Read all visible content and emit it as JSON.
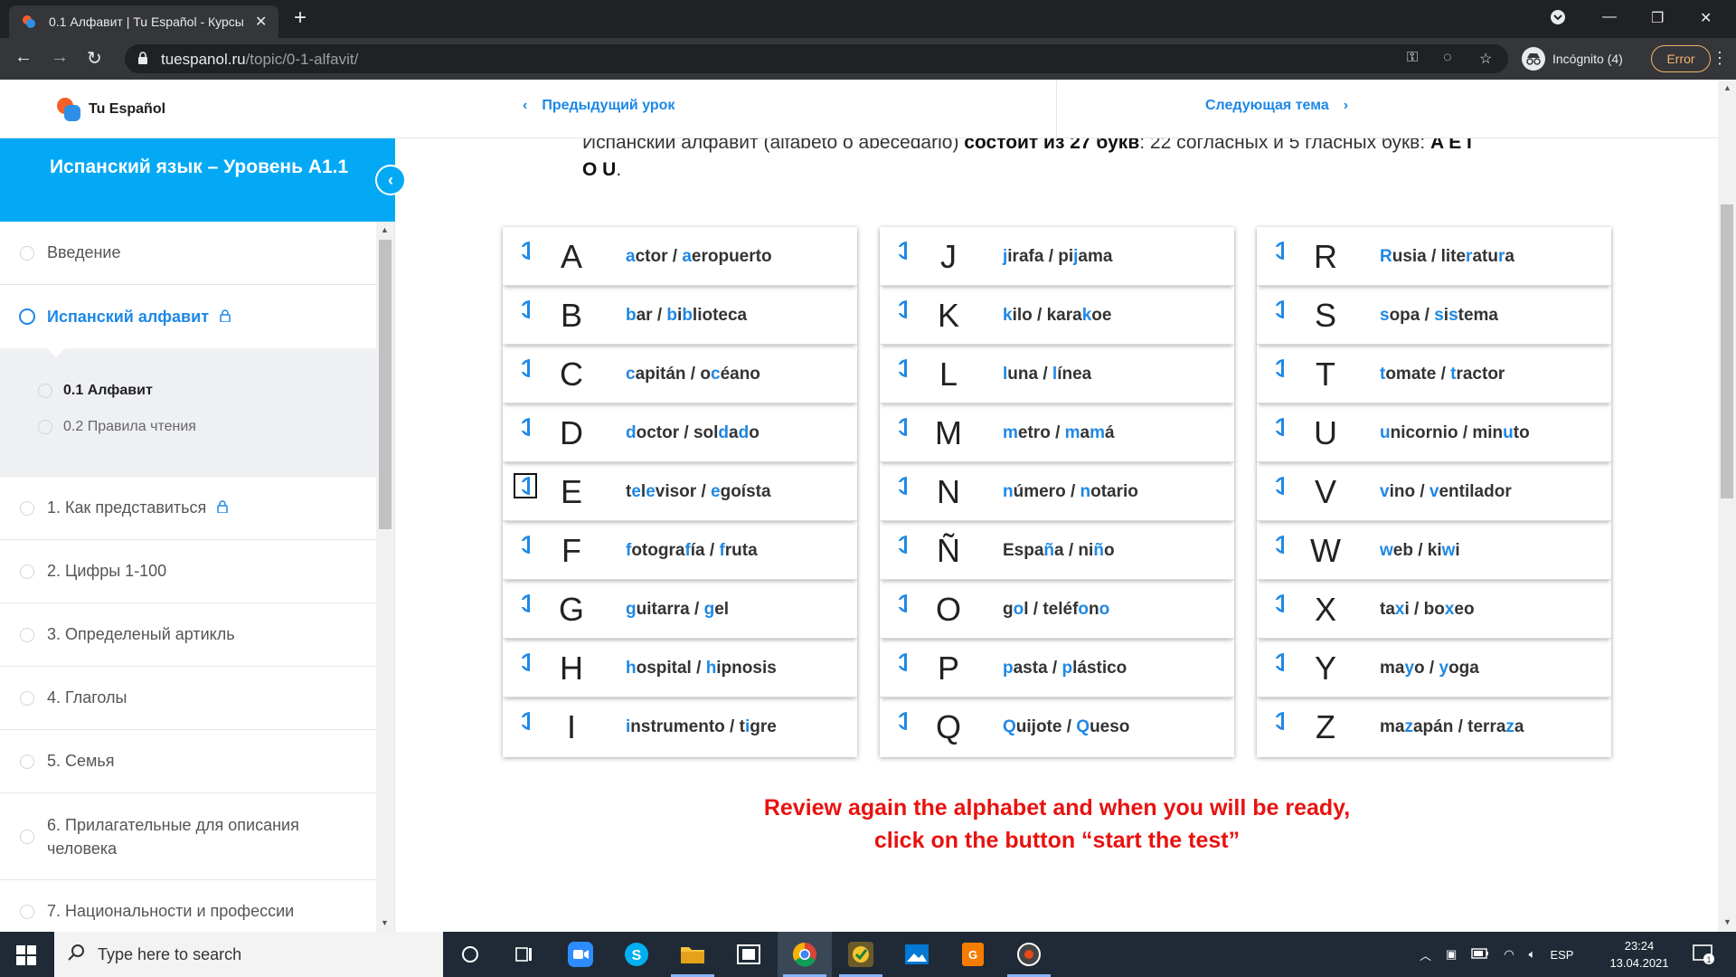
{
  "browser": {
    "tab_title": "0.1 Алфавит | Tu Español - Курсы",
    "url_host": "tuespanol.ru",
    "url_path": "/topic/0-1-alfavit/",
    "incognito_label": "Incógnito (4)",
    "error_label": "Error"
  },
  "header": {
    "logo_text": "Tu Español",
    "prev_label": "Предыдущий урок",
    "next_label": "Следующая тема"
  },
  "sidebar": {
    "course_title": "Испанский язык – Уровень A1.1",
    "items_top": [
      {
        "label": "Введение",
        "active": false,
        "locked": false
      },
      {
        "label": "Испанский алфавит",
        "active": true,
        "locked": true
      }
    ],
    "subtopics": [
      {
        "label": "0.1 Алфавит",
        "current": true
      },
      {
        "label": "0.2 Правила чтения",
        "current": false
      }
    ],
    "items_bottom": [
      {
        "label": "1. Как представиться",
        "locked": true
      },
      {
        "label": "2. Цифры 1-100",
        "locked": false
      },
      {
        "label": "3. Определеный артикль",
        "locked": false
      },
      {
        "label": "4. Глаголы",
        "locked": false
      },
      {
        "label": "5. Семья",
        "locked": false
      },
      {
        "label": "6. Прилагательные для описания человека",
        "locked": false
      },
      {
        "label": "7. Национальности и профессии",
        "locked": false
      }
    ]
  },
  "content": {
    "intro_part1": "Испанский алфавит (alfabeto o abecedario) ",
    "intro_bold1": "состоит из 27 букв",
    "intro_part2": ": 22 согласных и 5 гласных букв: ",
    "intro_bold2": "A E I O U",
    "intro_end": ".",
    "columns": [
      [
        {
          "letter": "A",
          "word": [
            [
              "",
              "a"
            ],
            [
              "ctor / ",
              ""
            ],
            [
              "",
              "a"
            ],
            [
              "eropuerto",
              ""
            ]
          ]
        },
        {
          "letter": "B",
          "word": [
            [
              "",
              "b"
            ],
            [
              "ar / ",
              ""
            ],
            [
              "",
              "b"
            ],
            [
              "i",
              ""
            ],
            [
              "",
              "b"
            ],
            [
              "lioteca",
              ""
            ]
          ]
        },
        {
          "letter": "C",
          "word": [
            [
              "",
              "c"
            ],
            [
              "apitán / o",
              ""
            ],
            [
              "",
              "c"
            ],
            [
              "éano",
              ""
            ]
          ]
        },
        {
          "letter": "D",
          "word": [
            [
              "",
              "d"
            ],
            [
              "octor / sol",
              ""
            ],
            [
              "",
              "d"
            ],
            [
              "a",
              ""
            ],
            [
              "",
              "d"
            ],
            [
              "o",
              ""
            ]
          ]
        },
        {
          "letter": "E",
          "word": [
            [
              "t",
              ""
            ],
            [
              "",
              "e"
            ],
            [
              "l",
              ""
            ],
            [
              "",
              "e"
            ],
            [
              "visor / ",
              ""
            ],
            [
              "",
              "e"
            ],
            [
              "goísta",
              ""
            ]
          ]
        },
        {
          "letter": "F",
          "word": [
            [
              "",
              "f"
            ],
            [
              "otogra",
              ""
            ],
            [
              "",
              "f"
            ],
            [
              "ía / ",
              ""
            ],
            [
              "",
              "f"
            ],
            [
              "ruta",
              ""
            ]
          ]
        },
        {
          "letter": "G",
          "word": [
            [
              "",
              "g"
            ],
            [
              "uitarra / ",
              ""
            ],
            [
              "",
              "g"
            ],
            [
              "el",
              ""
            ]
          ]
        },
        {
          "letter": "H",
          "word": [
            [
              "",
              "h"
            ],
            [
              "ospital / ",
              ""
            ],
            [
              "",
              "h"
            ],
            [
              "ipnosis",
              ""
            ]
          ]
        },
        {
          "letter": "I",
          "word": [
            [
              "",
              "i"
            ],
            [
              "nstrumento / t",
              ""
            ],
            [
              "",
              "i"
            ],
            [
              "gre",
              ""
            ]
          ]
        }
      ],
      [
        {
          "letter": "J",
          "word": [
            [
              "",
              "j"
            ],
            [
              "irafa / pi",
              ""
            ],
            [
              "",
              "j"
            ],
            [
              "ama",
              ""
            ]
          ]
        },
        {
          "letter": "K",
          "word": [
            [
              "",
              "k"
            ],
            [
              "ilo / kara",
              ""
            ],
            [
              "",
              "k"
            ],
            [
              "oe",
              ""
            ]
          ]
        },
        {
          "letter": "L",
          "word": [
            [
              "",
              "l"
            ],
            [
              "una / ",
              ""
            ],
            [
              "",
              "l"
            ],
            [
              "ínea",
              ""
            ]
          ]
        },
        {
          "letter": "M",
          "word": [
            [
              "",
              "m"
            ],
            [
              "etro / ",
              ""
            ],
            [
              "",
              "m"
            ],
            [
              "a",
              ""
            ],
            [
              "",
              "m"
            ],
            [
              "á",
              ""
            ]
          ]
        },
        {
          "letter": "N",
          "word": [
            [
              "",
              "n"
            ],
            [
              "úmero / ",
              ""
            ],
            [
              "",
              "n"
            ],
            [
              "otario",
              ""
            ]
          ]
        },
        {
          "letter": "Ñ",
          "word": [
            [
              "Espa",
              ""
            ],
            [
              "",
              "ñ"
            ],
            [
              "a / ni",
              ""
            ],
            [
              "",
              "ñ"
            ],
            [
              "o",
              ""
            ]
          ]
        },
        {
          "letter": "O",
          "word": [
            [
              "g",
              ""
            ],
            [
              "",
              "o"
            ],
            [
              "l / teléf",
              ""
            ],
            [
              "",
              "o"
            ],
            [
              "n",
              ""
            ],
            [
              "",
              "o"
            ]
          ]
        },
        {
          "letter": "P",
          "word": [
            [
              "",
              "p"
            ],
            [
              "asta / ",
              ""
            ],
            [
              "",
              "p"
            ],
            [
              "lástico",
              ""
            ]
          ]
        },
        {
          "letter": "Q",
          "word": [
            [
              "",
              "Q"
            ],
            [
              "uijote / ",
              ""
            ],
            [
              "",
              "Q"
            ],
            [
              "ueso",
              ""
            ]
          ]
        }
      ],
      [
        {
          "letter": "R",
          "word": [
            [
              "",
              "R"
            ],
            [
              "usia / lite",
              ""
            ],
            [
              "",
              "r"
            ],
            [
              "atu",
              ""
            ],
            [
              "",
              "r"
            ],
            [
              "a",
              ""
            ]
          ]
        },
        {
          "letter": "S",
          "word": [
            [
              "",
              "s"
            ],
            [
              "opa / ",
              ""
            ],
            [
              "",
              "s"
            ],
            [
              "i",
              ""
            ],
            [
              "",
              "s"
            ],
            [
              "tema",
              ""
            ]
          ]
        },
        {
          "letter": "T",
          "word": [
            [
              "",
              "t"
            ],
            [
              "omate / ",
              ""
            ],
            [
              "",
              "t"
            ],
            [
              "ractor",
              ""
            ]
          ]
        },
        {
          "letter": "U",
          "word": [
            [
              "",
              "u"
            ],
            [
              "nicornio / min",
              ""
            ],
            [
              "",
              "u"
            ],
            [
              "to",
              ""
            ]
          ]
        },
        {
          "letter": "V",
          "word": [
            [
              "",
              "v"
            ],
            [
              "ino / ",
              ""
            ],
            [
              "",
              "v"
            ],
            [
              "entilador",
              ""
            ]
          ]
        },
        {
          "letter": "W",
          "word": [
            [
              "",
              "w"
            ],
            [
              "eb / ki",
              ""
            ],
            [
              "",
              "w"
            ],
            [
              "i",
              ""
            ]
          ]
        },
        {
          "letter": "X",
          "word": [
            [
              "ta",
              ""
            ],
            [
              "",
              "x"
            ],
            [
              "i / bo",
              ""
            ],
            [
              "",
              "x"
            ],
            [
              "eo",
              ""
            ]
          ]
        },
        {
          "letter": "Y",
          "word": [
            [
              "ma",
              ""
            ],
            [
              "",
              "y"
            ],
            [
              "o / ",
              ""
            ],
            [
              "",
              "y"
            ],
            [
              "oga",
              ""
            ]
          ]
        },
        {
          "letter": "Z",
          "word": [
            [
              "ma",
              ""
            ],
            [
              "",
              "z"
            ],
            [
              "apán / terra",
              ""
            ],
            [
              "",
              "z"
            ],
            [
              "a",
              ""
            ]
          ]
        }
      ]
    ],
    "review_line1": "Review again the alphabet and when you will be ready,",
    "review_line2": "click on the button “start the test”"
  },
  "taskbar": {
    "search_placeholder": "Type here to search",
    "lang": "ESP",
    "time": "23:24",
    "date": "13.04.2021",
    "notif_count": "1"
  },
  "colors": {
    "accent": "#1e88e5",
    "sidebar_header": "#03a9f4",
    "review": "#e8120f"
  }
}
